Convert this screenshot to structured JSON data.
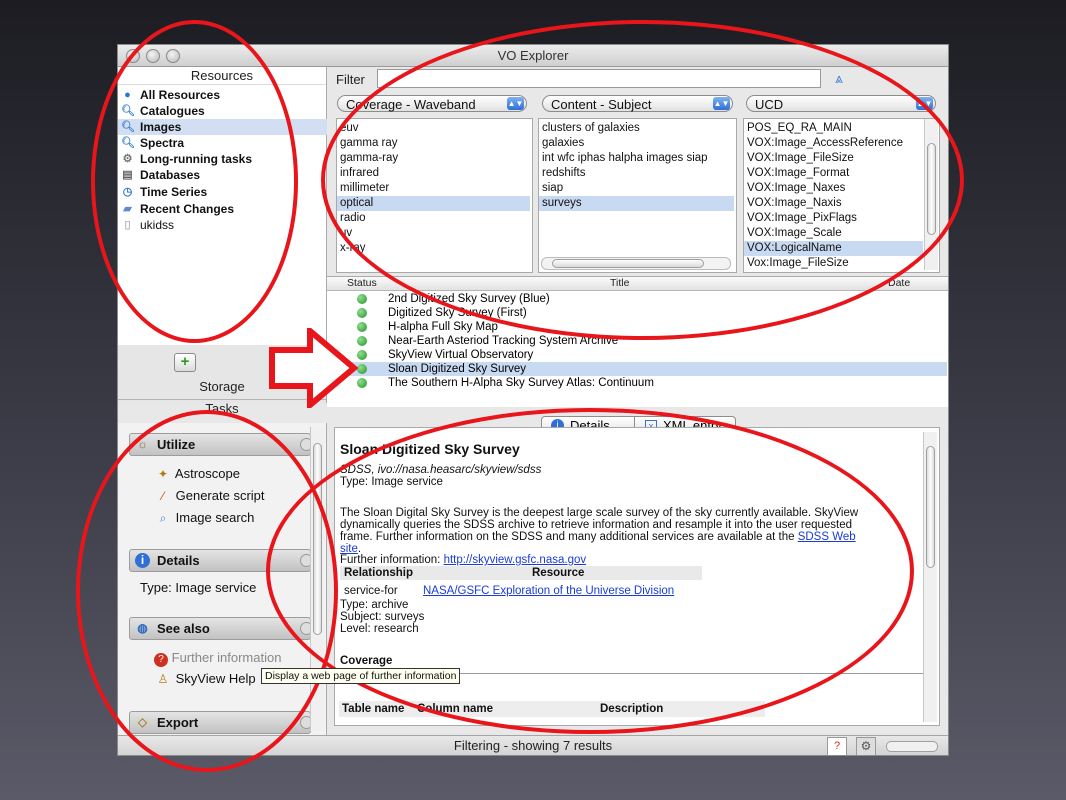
{
  "window": {
    "title": "VO Explorer"
  },
  "sidebar": {
    "heading": "Resources",
    "items": [
      {
        "label": "All Resources",
        "icon": "globe-icon"
      },
      {
        "label": "Catalogues",
        "icon": "magnifier-icon"
      },
      {
        "label": "Images",
        "icon": "magnifier-icon"
      },
      {
        "label": "Spectra",
        "icon": "magnifier-icon"
      },
      {
        "label": "Long-running tasks",
        "icon": "gears-icon"
      },
      {
        "label": "Databases",
        "icon": "database-icon"
      },
      {
        "label": "Time Series",
        "icon": "clock-icon"
      },
      {
        "label": "Recent Changes",
        "icon": "folder-icon"
      },
      {
        "label": "ukidss",
        "icon": "document-icon"
      }
    ],
    "storage_label": "Storage",
    "tasks_label": "Tasks"
  },
  "filter": {
    "label": "Filter",
    "value": "",
    "dropdowns": [
      "Coverage - Waveband",
      "Content - Subject",
      "UCD"
    ],
    "waveband": [
      "euv",
      "gamma ray",
      "gamma-ray",
      "infrared",
      "millimeter",
      "optical",
      "radio",
      "uv",
      "x-ray"
    ],
    "subject": [
      "clusters of galaxies",
      "galaxies",
      "int wfc iphas halpha images siap",
      "redshifts",
      "siap",
      "surveys"
    ],
    "ucd": [
      "POS_EQ_RA_MAIN",
      "VOX:Image_AccessReference",
      "VOX:Image_FileSize",
      "VOX:Image_Format",
      "VOX:Image_Naxes",
      "VOX:Image_Naxis",
      "VOX:Image_PixFlags",
      "VOX:Image_Scale",
      "VOX:LogicalName",
      "Vox:Image_FileSize"
    ]
  },
  "results": {
    "columns": [
      "Status",
      "Title",
      "Date"
    ],
    "rows": [
      "2nd Digitized Sky Survey (Blue)",
      "Digitized Sky Survey (First)",
      "H-alpha Full Sky Map",
      "Near-Earth Asteriod Tracking System Archive",
      "SkyView Virtual Observatory",
      "Sloan Digitized Sky Survey",
      "The Southern H-Alpha Sky Survey Atlas: Continuum"
    ]
  },
  "tasks": {
    "utilize": {
      "heading": "Utilize",
      "items": [
        "Astroscope",
        "Generate script",
        "Image search"
      ]
    },
    "details": {
      "heading": "Details",
      "text": "Type: Image service"
    },
    "see_also": {
      "heading": "See also",
      "items": [
        "Further information",
        "SkyView Help"
      ]
    },
    "export": {
      "heading": "Export"
    },
    "tooltip": "Display a web page of further information"
  },
  "detail": {
    "tabs": [
      "Details",
      "XML entry"
    ],
    "title": "Sloan Digitized Sky Survey",
    "id_line": "SDSS, ivo://nasa.heasarc/skyview/sdss",
    "type_line": "Type: Image service",
    "desc1": "The Sloan Digital Sky Survey is the deepest large scale survey of the sky currently available. SkyView",
    "desc2": "dynamically queries the SDSS archive to retrieve information and resample it into the user requested",
    "desc3": "frame. Further information on the SDSS and many additional services are available at the",
    "desc_link": "SDSS Web",
    "desc_link2": "site",
    "further_label": "Further information:",
    "further_url": "http://skyview.gsfc.nasa.gov",
    "rel_headers": [
      "Relationship",
      "Resource"
    ],
    "rel_value": "service-for",
    "rel_resource": "NASA/GSFC Exploration of the Universe Division",
    "type_archive": "Type: archive",
    "subject_line": "Subject: surveys",
    "level_line": "Level: research",
    "coverage_heading": "Coverage",
    "table_headers": [
      "Table name",
      "Column name",
      "Description"
    ]
  },
  "status": {
    "text": "Filtering - showing 7 results"
  }
}
